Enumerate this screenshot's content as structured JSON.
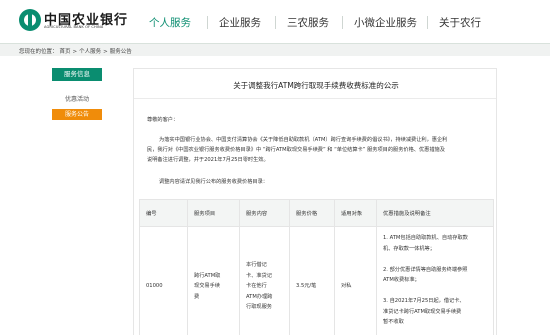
{
  "brand": {
    "name_cn": "中国农业银行",
    "name_en": "AGRICULTURAL BANK OF CHINA",
    "color": "#0a8d70"
  },
  "nav": {
    "items": [
      {
        "label": "个人服务",
        "active": true
      },
      {
        "label": "企业服务",
        "active": false
      },
      {
        "label": "三农服务",
        "active": false
      },
      {
        "label": "小微企业服务",
        "active": false
      },
      {
        "label": "关于农行",
        "active": false
      }
    ]
  },
  "breadcrumb": {
    "prefix": "您现在的位置：",
    "items": [
      "首页",
      "个人服务",
      "服务公告"
    ],
    "separator": ">"
  },
  "sidebar": {
    "title": "服务信息",
    "items": [
      {
        "label": "优惠活动",
        "active": false
      },
      {
        "label": "服务公告",
        "active": true
      }
    ],
    "active_color": "#f08c0a"
  },
  "article": {
    "title": "关于调整我行ATM跨行取现手续费收费标准的公示",
    "greeting": "尊敬的客户：",
    "body_lines": [
      "为落实中国银行业协会、中国支付清算协会《关于降低自助取款机（ATM）跨行查询手续费的倡议书》，持续减费让利，惠企利",
      "民，我行对《中国农业银行服务收费价格目录》中 “跨行ATM取现交易手续费” 和 “单位结算卡” 服务项目的服务价格、优惠措施及",
      "说明备注进行调整，并于2021年7月25日零时生效。"
    ],
    "intro_table": "调整内容请详见我行公布的服务收费价格目录："
  },
  "table": {
    "headers": [
      "编号",
      "服务项目",
      "服务内容",
      "服务价格",
      "适用对象",
      "优惠措施及说明备注"
    ],
    "rows": [
      {
        "code": "01000",
        "item": [
          "跨行ATM取",
          "现交易手续",
          "费"
        ],
        "content": [
          "本行借记",
          "卡、准贷记",
          "卡在他行",
          "ATM办理跨",
          "行取现服务"
        ],
        "price": "3.5元/笔",
        "target": "对私",
        "remarks": [
          "1. ATM包括自助取款机、自动存取款",
          "机、存取款一体机等；",
          "",
          "2. 部分优惠详情等自助服务终端参照",
          "ATM收费标准；",
          "",
          "3. 自2021年7月25日起，借记卡、",
          "准贷记卡跨行ATM取现交易手续费",
          "暂不收取"
        ]
      }
    ]
  }
}
